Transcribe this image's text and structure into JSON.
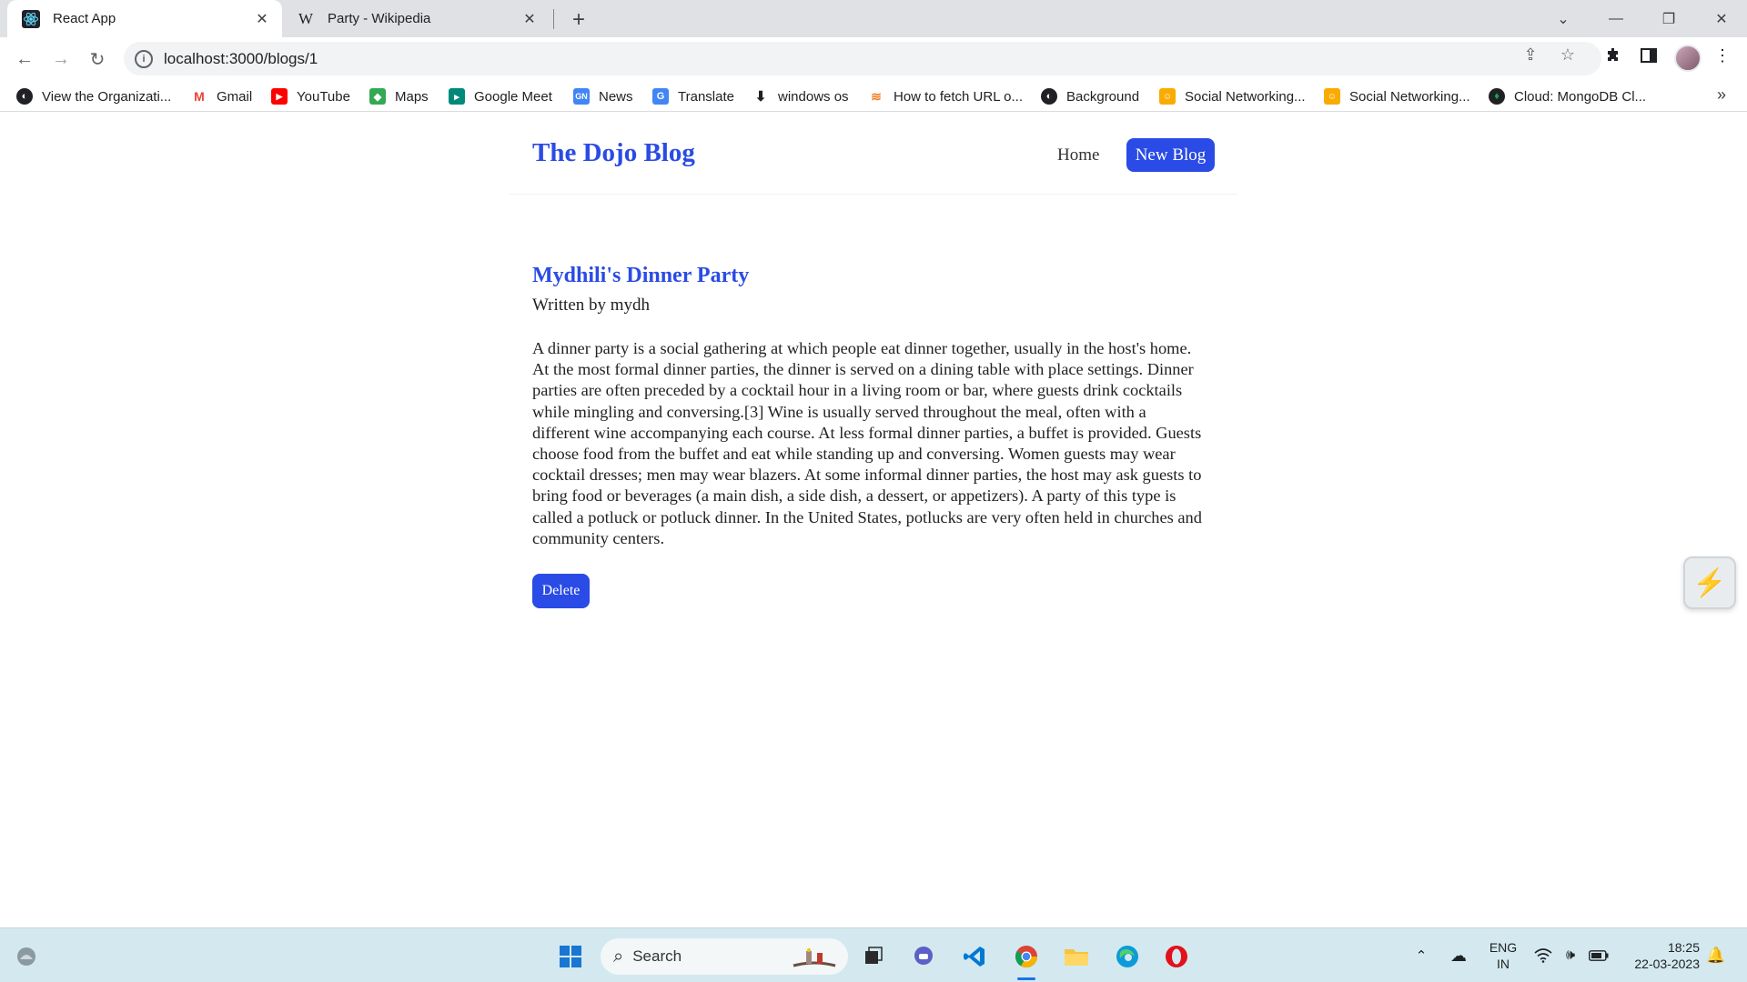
{
  "browser": {
    "tabs": [
      {
        "title": "React App",
        "icon": "react-icon",
        "active": true
      },
      {
        "title": "Party - Wikipedia",
        "icon": "wikipedia-icon",
        "active": false
      }
    ],
    "url": "localhost:3000/blogs/1",
    "bookmarks": [
      {
        "label": "View the Organizati...",
        "icon": "globe-icon",
        "color": "#202124"
      },
      {
        "label": "Gmail",
        "icon": "gmail-icon",
        "color": "#ea4335"
      },
      {
        "label": "YouTube",
        "icon": "youtube-icon",
        "color": "#ff0000"
      },
      {
        "label": "Maps",
        "icon": "maps-icon",
        "color": "#34a853"
      },
      {
        "label": "Google Meet",
        "icon": "meet-icon",
        "color": "#00897b"
      },
      {
        "label": "News",
        "icon": "news-icon",
        "color": "#4285f4"
      },
      {
        "label": "Translate",
        "icon": "translate-icon",
        "color": "#4285f4"
      },
      {
        "label": "windows os",
        "icon": "download-icon",
        "color": "#202124"
      },
      {
        "label": "How to fetch URL o...",
        "icon": "stackoverflow-icon",
        "color": "#f48024"
      },
      {
        "label": "Background",
        "icon": "globe-icon",
        "color": "#202124"
      },
      {
        "label": "Social Networking...",
        "icon": "social-icon",
        "color": "#f9ab00"
      },
      {
        "label": "Social Networking...",
        "icon": "social-icon",
        "color": "#f9ab00"
      },
      {
        "label": "Cloud: MongoDB Cl...",
        "icon": "mongodb-icon",
        "color": "#13aa52"
      }
    ]
  },
  "site": {
    "brand": "The Dojo Blog",
    "nav_home": "Home",
    "nav_new_blog": "New Blog",
    "accent_color": "#2a4be5"
  },
  "blog": {
    "title": "Mydhili's Dinner Party",
    "author_line": "Written by mydh",
    "body": "A dinner party is a social gathering at which people eat dinner together, usually in the host's home. At the most formal dinner parties, the dinner is served on a dining table with place settings. Dinner parties are often preceded by a cocktail hour in a living room or bar, where guests drink cocktails while mingling and conversing.[3] Wine is usually served throughout the meal, often with a different wine accompanying each course. At less formal dinner parties, a buffet is provided. Guests choose food from the buffet and eat while standing up and conversing. Women guests may wear cocktail dresses; men may wear blazers. At some informal dinner parties, the host may ask guests to bring food or beverages (a main dish, a side dish, a dessert, or appetizers). A party of this type is called a potluck or potluck dinner. In the United States, potlucks are very often held in churches and community centers.",
    "delete_label": "Delete"
  },
  "taskbar": {
    "search_placeholder": "Search",
    "lang_primary": "ENG",
    "lang_secondary": "IN",
    "time": "18:25",
    "date": "22-03-2023"
  }
}
